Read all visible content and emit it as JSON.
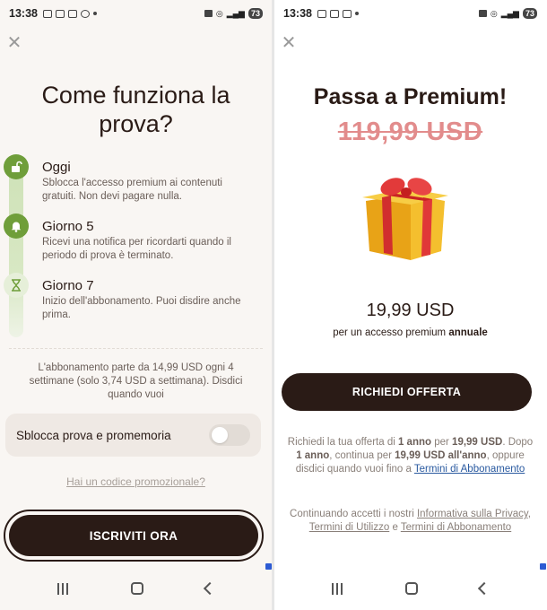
{
  "status": {
    "time": "13:38",
    "battery": "73"
  },
  "left": {
    "title": "Come funziona la prova?",
    "steps": [
      {
        "title": "Oggi",
        "desc": "Sblocca l'accesso premium ai contenuti gratuiti. Non devi pagare nulla.",
        "icon": "unlock-icon"
      },
      {
        "title": "Giorno 5",
        "desc": "Ricevi una notifica per ricordarti quando il periodo di prova è terminato.",
        "icon": "bell-icon"
      },
      {
        "title": "Giorno 7",
        "desc": "Inizio dell'abbonamento. Puoi disdire anche prima.",
        "icon": "hourglass-icon"
      }
    ],
    "note": "L'abbonamento parte da 14,99 USD ogni 4 settimane (solo 3,74 USD a settimana). Disdici quando vuoi",
    "toggle_label": "Sblocca prova e promemoria",
    "toggle_on": false,
    "promo_link": "Hai un codice promozionale?",
    "cta": "ISCRIVITI ORA"
  },
  "right": {
    "title": "Passa a Premium!",
    "old_price": "119,99 USD",
    "price": "19,99 USD",
    "price_sub_prefix": "per un accesso premium ",
    "price_sub_bold": "annuale",
    "cta": "RICHIEDI OFFERTA",
    "terms": {
      "t1": "Richiedi la tua offerta di ",
      "b1": "1 anno",
      "t2": " per ",
      "b2": "19,99 USD",
      "t3": ". Dopo ",
      "b3": "1 anno",
      "t4": ", continua per ",
      "b4": "19,99 USD all'anno",
      "t5": ", oppure disdici quando vuoi fino a ",
      "link": "Termini di Abbonamento"
    },
    "legal": {
      "t1": "Continuando accetti i nostri ",
      "l1": "Informativa sulla Privacy",
      "t2": ", ",
      "l2": "Termini di Utilizzo",
      "t3": " e ",
      "l3": "Termini di Abbonamento"
    }
  },
  "colors": {
    "brand_dark": "#2a1b16",
    "accent_green": "#6f9e3a",
    "strike_red": "#e28c8c",
    "link_blue": "#2a5aa0"
  }
}
